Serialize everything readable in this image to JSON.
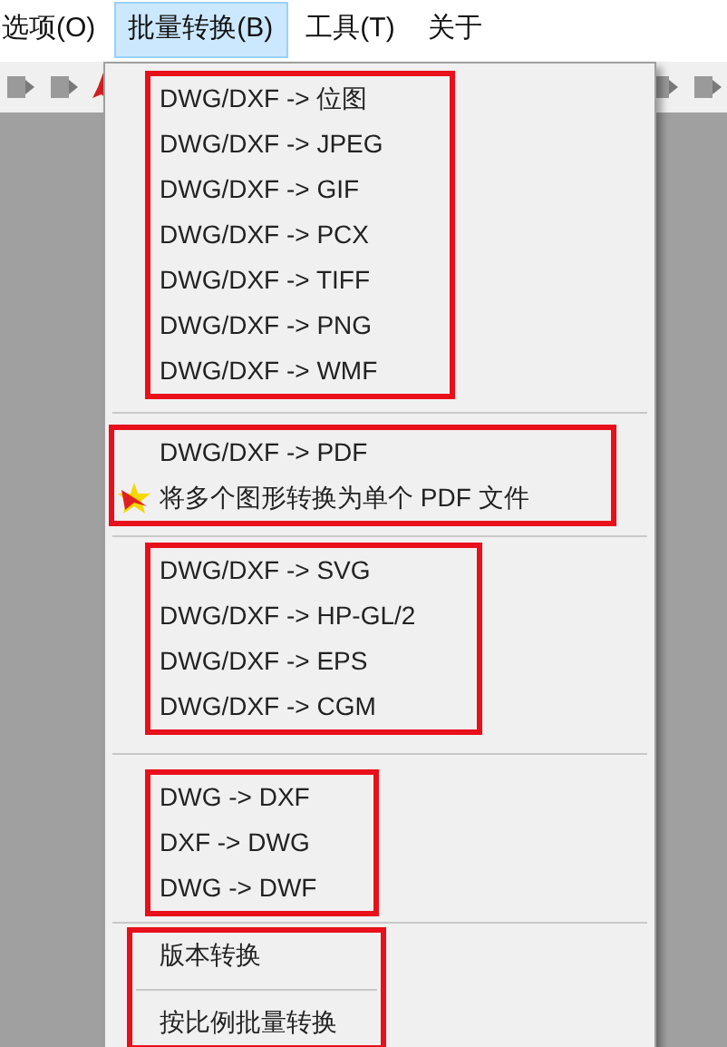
{
  "menu_bar": [
    {
      "label": "选项(O)",
      "selected": false
    },
    {
      "label": "批量转换(B)",
      "selected": true
    },
    {
      "label": "工具(T)",
      "selected": false
    },
    {
      "label": "关于",
      "selected": false
    }
  ],
  "dropdown": [
    {
      "items": [
        {
          "kind": "item",
          "label": "DWG/DXF -> 位图"
        },
        {
          "kind": "item",
          "label": "DWG/DXF -> JPEG"
        },
        {
          "kind": "item",
          "label": "DWG/DXF -> GIF"
        },
        {
          "kind": "item",
          "label": "DWG/DXF -> PCX"
        },
        {
          "kind": "item",
          "label": "DWG/DXF -> TIFF"
        },
        {
          "kind": "item",
          "label": "DWG/DXF -> PNG"
        },
        {
          "kind": "item",
          "label": "DWG/DXF -> WMF"
        }
      ]
    },
    {
      "items": [
        {
          "kind": "item",
          "label": "DWG/DXF -> PDF"
        },
        {
          "kind": "icon_item",
          "label": "将多个图形转换为单个 PDF 文件"
        }
      ]
    },
    {
      "items": [
        {
          "kind": "item",
          "label": "DWG/DXF -> SVG"
        },
        {
          "kind": "item",
          "label": "DWG/DXF -> HP-GL/2"
        },
        {
          "kind": "item",
          "label": "DWG/DXF -> EPS"
        },
        {
          "kind": "item",
          "label": "DWG/DXF -> CGM"
        }
      ]
    },
    {
      "items": [
        {
          "kind": "item",
          "label": "DWG -> DXF"
        },
        {
          "kind": "item",
          "label": "DXF -> DWG"
        },
        {
          "kind": "item",
          "label": "DWG -> DWF"
        }
      ]
    },
    {
      "items": [
        {
          "kind": "item",
          "label": "版本转换"
        },
        {
          "kind": "separator"
        },
        {
          "kind": "item",
          "label": "按比例批量转换"
        }
      ]
    }
  ]
}
